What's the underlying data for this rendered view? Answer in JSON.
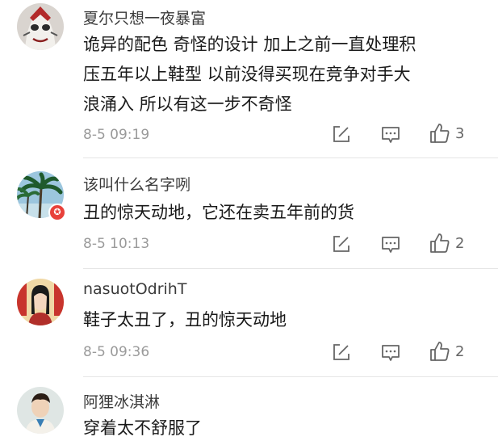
{
  "comments": [
    {
      "username": "夏尔只想一夜暴富",
      "lines": [
        "诡异的配色 奇怪的设计 加上之前一直处理积",
        "压五年以上鞋型 以前没得买现在竞争对手大",
        "浪涌入 所以有这一步不奇怪"
      ],
      "time": "8-5 09:19",
      "likes": "3"
    },
    {
      "username": "该叫什么名字咧",
      "badge": "✪",
      "lines": [
        "丑的惊天动地，它还在卖五年前的货"
      ],
      "time": "8-5 10:13",
      "likes": "2"
    },
    {
      "username": "nasuotOdrihT",
      "lines": [
        "鞋子太丑了，丑的惊天动地"
      ],
      "time": "8-5 09:36",
      "likes": "2"
    },
    {
      "username": "阿狸冰淇淋",
      "lines": [
        "穿着太不舒服了"
      ]
    }
  ],
  "icons": {
    "share": "edit-share-icon",
    "reply": "comment-bubble-icon",
    "like": "thumbs-up-icon"
  },
  "colors": {
    "badge": "#e8413a",
    "meta": "#9a9a9a"
  }
}
